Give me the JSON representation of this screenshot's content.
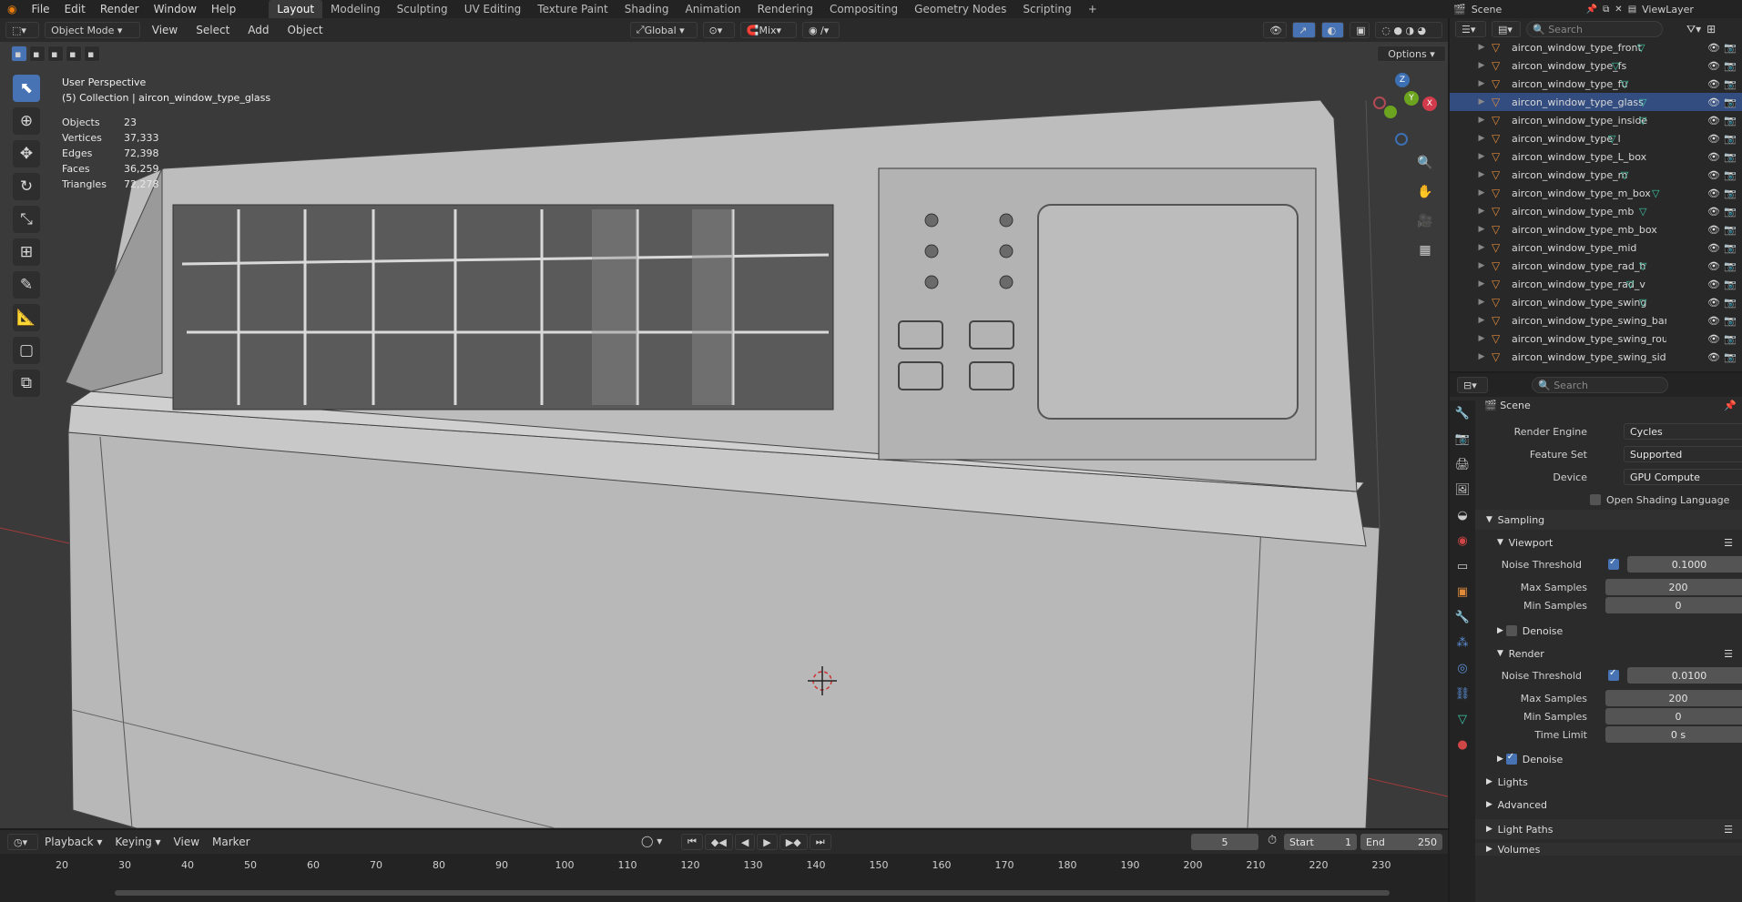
{
  "menus": [
    "File",
    "Edit",
    "Render",
    "Window",
    "Help"
  ],
  "workspace_tabs": [
    "Layout",
    "Modeling",
    "Sculpting",
    "UV Editing",
    "Texture Paint",
    "Shading",
    "Animation",
    "Rendering",
    "Compositing",
    "Geometry Nodes",
    "Scripting"
  ],
  "active_tab": "Layout",
  "add_workspace": "+",
  "scene": {
    "label": "Scene",
    "viewlayer": "ViewLayer"
  },
  "viewport": {
    "mode": "Object Mode",
    "menus": [
      "View",
      "Select",
      "Add",
      "Object"
    ],
    "transform_orientation": "Global",
    "snap_mode": "Mix",
    "options_label": "Options",
    "perspective": "User Perspective",
    "collection_info": "(5) Collection | aircon_window_type_glass",
    "stats": [
      {
        "k": "Objects",
        "v": "23"
      },
      {
        "k": "Vertices",
        "v": "37,333"
      },
      {
        "k": "Edges",
        "v": "72,398"
      },
      {
        "k": "Faces",
        "v": "36,259"
      },
      {
        "k": "Triangles",
        "v": "72,278"
      }
    ],
    "gizmo": {
      "z": "Z",
      "x": "X",
      "y": "Y"
    }
  },
  "outliner": {
    "search_placeholder": "Search",
    "items": [
      {
        "name": "aircon_window_type_front",
        "selected": false
      },
      {
        "name": "aircon_window_type_fs",
        "selected": false
      },
      {
        "name": "aircon_window_type_fu",
        "selected": false
      },
      {
        "name": "aircon_window_type_glass",
        "selected": true
      },
      {
        "name": "aircon_window_type_inside",
        "selected": false
      },
      {
        "name": "aircon_window_type_l",
        "selected": false
      },
      {
        "name": "aircon_window_type_L_box",
        "selected": false
      },
      {
        "name": "aircon_window_type_m",
        "selected": false
      },
      {
        "name": "aircon_window_type_m_box",
        "selected": false
      },
      {
        "name": "aircon_window_type_mb",
        "selected": false
      },
      {
        "name": "aircon_window_type_mb_box",
        "selected": false
      },
      {
        "name": "aircon_window_type_mid",
        "selected": false
      },
      {
        "name": "aircon_window_type_rad_h",
        "selected": false
      },
      {
        "name": "aircon_window_type_rad_v",
        "selected": false
      },
      {
        "name": "aircon_window_type_swing",
        "selected": false
      },
      {
        "name": "aircon_window_type_swing_bar",
        "selected": false
      },
      {
        "name": "aircon_window_type_swing_round",
        "selected": false
      },
      {
        "name": "aircon_window_type_swing_side",
        "selected": false
      }
    ]
  },
  "properties": {
    "search_placeholder": "Search",
    "context": "Scene",
    "render_engine": {
      "label": "Render Engine",
      "value": "Cycles"
    },
    "feature_set": {
      "label": "Feature Set",
      "value": "Supported"
    },
    "device": {
      "label": "Device",
      "value": "GPU Compute"
    },
    "osl": "Open Shading Language",
    "sampling": "Sampling",
    "viewport_panel": {
      "title": "Viewport",
      "noise_threshold": {
        "label": "Noise Threshold",
        "value": "0.1000"
      },
      "max_samples": {
        "label": "Max Samples",
        "value": "200"
      },
      "min_samples": {
        "label": "Min Samples",
        "value": "0"
      },
      "denoise": "Denoise"
    },
    "render_panel": {
      "title": "Render",
      "noise_threshold": {
        "label": "Noise Threshold",
        "value": "0.0100"
      },
      "max_samples": {
        "label": "Max Samples",
        "value": "200"
      },
      "min_samples": {
        "label": "Min Samples",
        "value": "0"
      },
      "time_limit": {
        "label": "Time Limit",
        "value": "0 s"
      },
      "denoise": "Denoise"
    },
    "lights": "Lights",
    "advanced": "Advanced",
    "light_paths": "Light Paths",
    "volumes": "Volumes"
  },
  "timeline": {
    "menus": [
      "Playback",
      "Keying",
      "View",
      "Marker"
    ],
    "current_frame": "5",
    "start_label": "Start",
    "start": "1",
    "end_label": "End",
    "end": "250",
    "ticks": [
      "20",
      "30",
      "40",
      "50",
      "60",
      "70",
      "80",
      "90",
      "100",
      "110",
      "120",
      "130",
      "140",
      "150",
      "160",
      "170",
      "180",
      "190",
      "200",
      "210",
      "220",
      "230"
    ]
  },
  "colors": {
    "accent": "#4772b3",
    "selected_row": "#334d80",
    "modifier_icon": "#3ec7a6",
    "mesh_icon": "#e08a3a"
  }
}
